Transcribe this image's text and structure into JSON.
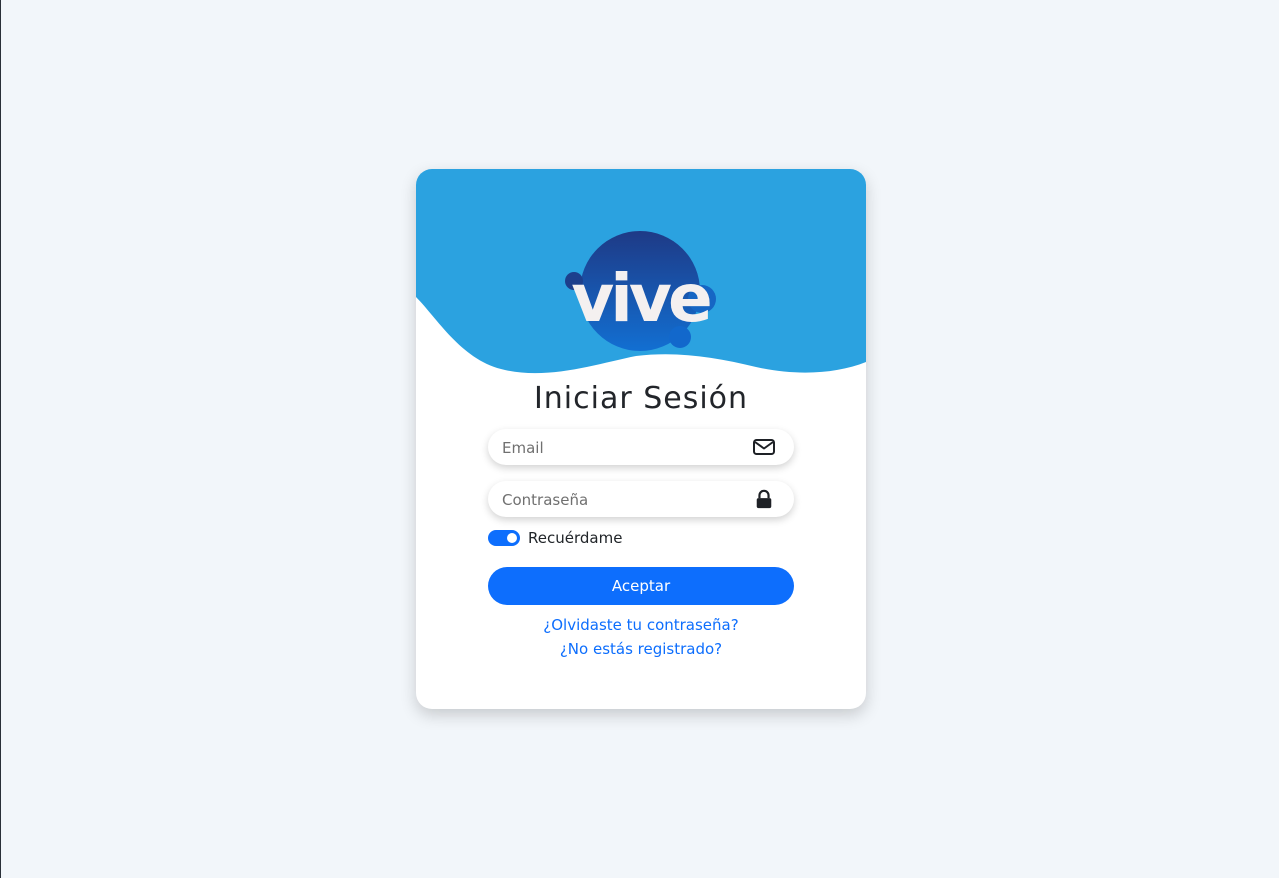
{
  "logo": {
    "text": "vive",
    "colors": {
      "circle": "#1c3f8f",
      "circle_light": "#1a6fd0",
      "letters": "#f4f0f0"
    }
  },
  "header": {
    "wave_color": "#2ba2e0"
  },
  "form": {
    "title": "Iniciar Sesión",
    "email": {
      "value": "",
      "placeholder": "Email",
      "icon": "envelope-icon"
    },
    "password": {
      "value": "",
      "placeholder": "Contraseña",
      "icon": "lock-icon"
    },
    "remember": {
      "label": "Recuérdame",
      "checked": true
    },
    "submit_label": "Aceptar",
    "forgot_link": "¿Olvidaste tu contraseña?",
    "register_link": "¿No estás registrado?"
  },
  "colors": {
    "primary": "#0d6efd",
    "background": "#f2f6fa"
  }
}
